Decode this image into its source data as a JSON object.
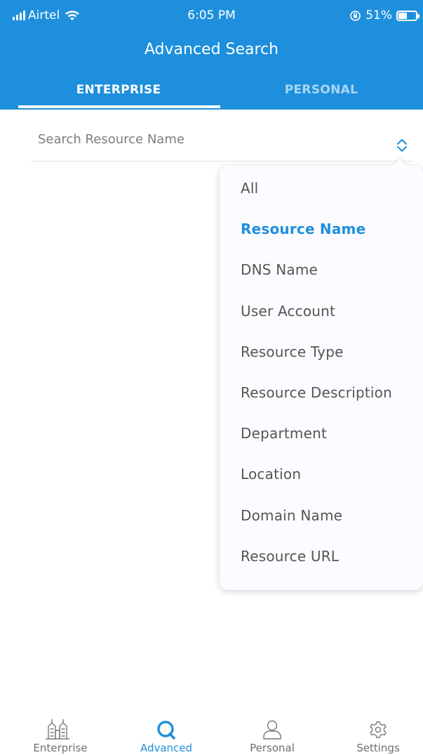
{
  "status_bar": {
    "carrier": "Airtel",
    "time": "6:05 PM",
    "battery": "51%",
    "battery_level": 0.51
  },
  "header": {
    "title": "Advanced Search"
  },
  "tabs": [
    {
      "label": "ENTERPRISE",
      "active": true
    },
    {
      "label": "PERSONAL",
      "active": false
    }
  ],
  "search": {
    "value": "",
    "placeholder": "Search Resource Name"
  },
  "filter_options": [
    {
      "label": "All",
      "selected": false
    },
    {
      "label": "Resource Name",
      "selected": true
    },
    {
      "label": "DNS Name",
      "selected": false
    },
    {
      "label": "User Account",
      "selected": false
    },
    {
      "label": "Resource Type",
      "selected": false
    },
    {
      "label": "Resource Description",
      "selected": false
    },
    {
      "label": "Department",
      "selected": false
    },
    {
      "label": "Location",
      "selected": false
    },
    {
      "label": "Domain Name",
      "selected": false
    },
    {
      "label": "Resource URL",
      "selected": false
    }
  ],
  "bottom_nav": [
    {
      "label": "Enterprise",
      "icon": "enterprise-icon",
      "active": false
    },
    {
      "label": "Advanced",
      "icon": "search-icon",
      "active": true
    },
    {
      "label": "Personal",
      "icon": "person-icon",
      "active": false
    },
    {
      "label": "Settings",
      "icon": "gear-icon",
      "active": false
    }
  ],
  "colors": {
    "accent": "#1e8fdc",
    "inactive_tab": "#a8d6f5",
    "muted": "#6e6e6e"
  }
}
